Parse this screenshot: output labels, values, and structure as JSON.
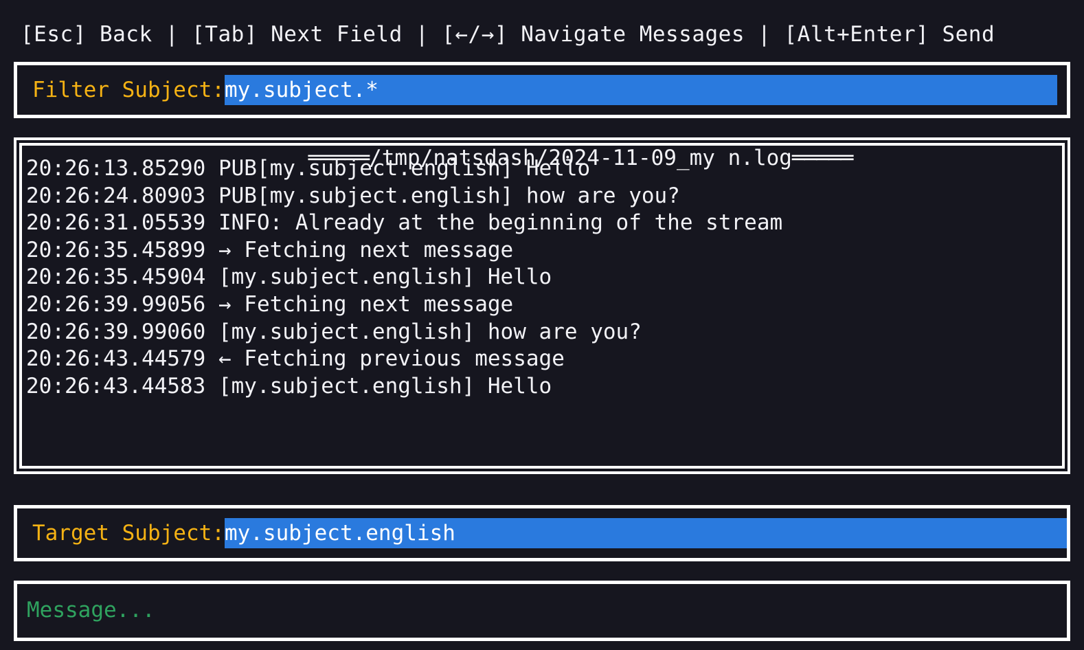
{
  "window": {
    "background_color": "#16161f",
    "border_color": "#ffffff",
    "text_color": "#f2f2f6"
  },
  "header": {
    "hints": "[Esc] Back | [Tab] Next Field | [←/→] Navigate Messages | [Alt+Enter] Send",
    "shortcuts": [
      {
        "key": "[Esc]",
        "action": "Back"
      },
      {
        "key": "[Tab]",
        "action": "Next Field"
      },
      {
        "key": "[←/→]",
        "action": "Navigate Messages"
      },
      {
        "key": "[Alt+Enter]",
        "action": "Send"
      }
    ]
  },
  "filter_field": {
    "label": "Filter Subject:",
    "value": "my.subject.*",
    "label_color": "#f5b214",
    "value_background": "#2a7ade",
    "value_color": "#ffffff"
  },
  "log_panel": {
    "title": "/tmp/natsdash/2024-11-09_my n.log",
    "rule_left": "═════",
    "rule_right": "═════",
    "lines": [
      "20:26:13.85290 PUB[my.subject.english] Hello",
      "20:26:24.80903 PUB[my.subject.english] how are you?",
      "20:26:31.05539 INFO: Already at the beginning of the stream",
      "20:26:35.45899 → Fetching next message",
      "20:26:35.45904 [my.subject.english] Hello",
      "20:26:39.99056 → Fetching next message",
      "20:26:39.99060 [my.subject.english] how are you?",
      "20:26:43.44579 ← Fetching previous message",
      "20:26:43.44583 [my.subject.english] Hello"
    ]
  },
  "target_field": {
    "label": "Target Subject:",
    "value": "my.subject.english",
    "label_color": "#f5b214",
    "value_background": "#2a7ade",
    "value_color": "#ffffff"
  },
  "message_field": {
    "placeholder": "Message...",
    "value": "",
    "placeholder_color": "#2fa35f"
  }
}
